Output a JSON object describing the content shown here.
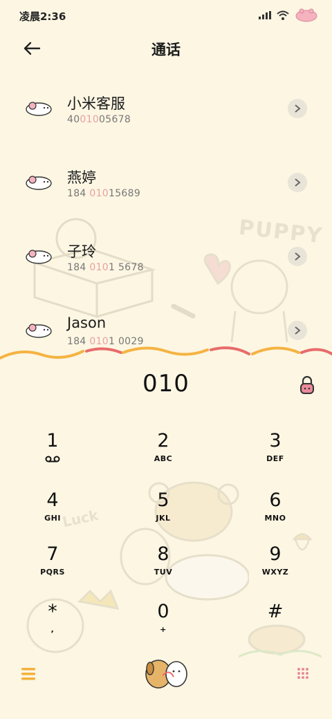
{
  "status": {
    "time": "凌晨2:36"
  },
  "appbar": {
    "title": "通话"
  },
  "contacts": [
    {
      "name": "小米客服",
      "num_pre": "40",
      "num_hl": "010",
      "num_post": "05678"
    },
    {
      "name": "燕婷",
      "num_pre": "184 ",
      "num_hl": "010",
      "num_post": "15689"
    },
    {
      "name": "子玲",
      "num_pre": "184 ",
      "num_hl": "010",
      "num_post": "1 5678"
    },
    {
      "name": "Jason",
      "num_pre": "184 ",
      "num_hl": "010",
      "num_post": "1 0029"
    }
  ],
  "dialer": {
    "input": "010"
  },
  "keys": [
    {
      "digit": "1",
      "letters": ""
    },
    {
      "digit": "2",
      "letters": "ABC"
    },
    {
      "digit": "3",
      "letters": "DEF"
    },
    {
      "digit": "4",
      "letters": "GHI"
    },
    {
      "digit": "5",
      "letters": "JKL"
    },
    {
      "digit": "6",
      "letters": "MNO"
    },
    {
      "digit": "7",
      "letters": "PQRS"
    },
    {
      "digit": "8",
      "letters": "TUV"
    },
    {
      "digit": "9",
      "letters": "WXYZ"
    },
    {
      "digit": "*",
      "letters": ","
    },
    {
      "digit": "0",
      "letters": "+"
    },
    {
      "digit": "#",
      "letters": ""
    }
  ],
  "decor": {
    "puppy": "PUPPY",
    "luck": "Luck"
  },
  "icons": {
    "back": "back-arrow-icon",
    "chevron": "chevron-right-icon",
    "voicemail": "voicemail-icon",
    "lock": "lock-icon",
    "menu": "menu-icon",
    "dialpad": "dialpad-icon",
    "call": "call-button-dog-icon"
  },
  "colors": {
    "background": "#fcf6e3",
    "highlight": "#e9a0a0",
    "wave_orange": "#f5b342",
    "wave_red": "#e86b6b",
    "menu": "#f3b13c",
    "dialpad": "#e98b9a"
  }
}
